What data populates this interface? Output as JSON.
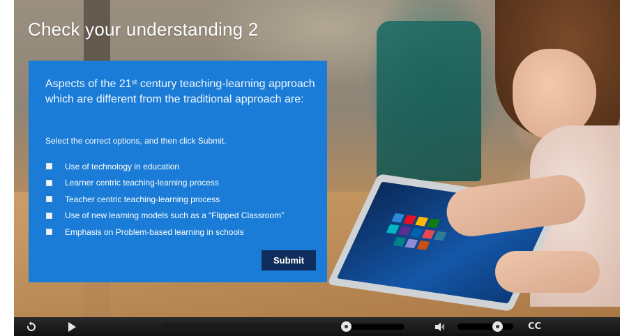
{
  "slide": {
    "title": "Check your understanding 2",
    "question": {
      "before": "Aspects of the 21",
      "superscript": "st",
      "after": " century teaching-learning approach which are different from the traditional approach are:"
    },
    "instruction": "Select the correct options, and then click Submit.",
    "options": [
      {
        "label": "Use of technology in education",
        "checked": false
      },
      {
        "label": "Learner centric teaching-learning process",
        "checked": false
      },
      {
        "label": "Teacher centric teaching-learning process",
        "checked": false
      },
      {
        "label": "Use of new learning models such as a “Flipped Classroom”",
        "checked": false
      },
      {
        "label": "Emphasis on Problem-based learning in schools",
        "checked": false
      }
    ],
    "submit_label": "Submit",
    "colors": {
      "panel": "#1a7cd6",
      "submit": "#0f2d5c"
    }
  },
  "player": {
    "icons": [
      "replay-icon",
      "play-icon",
      "volume-icon"
    ],
    "seek_progress": 0.76,
    "volume_level": 0.72,
    "cc_label": "CC"
  }
}
